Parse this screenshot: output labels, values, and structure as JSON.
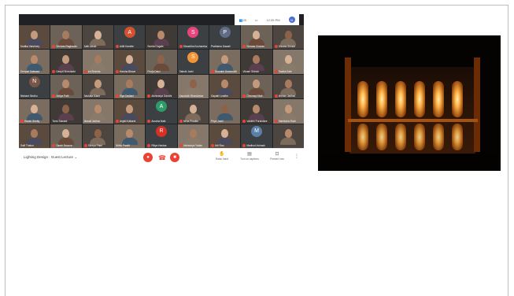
{
  "meeting": {
    "title": "Lighting Design : Guest Lecture",
    "time": "12:35 PM",
    "top_icons": {
      "people": "25",
      "chat_icon": "chat-icon"
    },
    "self_initial": "N",
    "controls": {
      "mic": "mic-off-icon",
      "hangup": "hangup-icon",
      "camera": "camera-off-icon"
    },
    "actions": [
      {
        "label": "Raise hand",
        "glyph": "✋"
      },
      {
        "label": "Turn on captions",
        "glyph": "▤"
      },
      {
        "label": "Present now",
        "glyph": "⊡"
      }
    ]
  },
  "participants": [
    {
      "name": "Kratika Varshney",
      "kind": "video",
      "muted": false
    },
    {
      "name": "Srinivas Raghavan",
      "kind": "video",
      "muted": true
    },
    {
      "name": "Aditi Lakde",
      "kind": "video",
      "muted": false
    },
    {
      "name": "Aditi Kamble",
      "kind": "initial",
      "initial": "A",
      "color": "#d35230",
      "muted": true
    },
    {
      "name": "Sneha Gugale",
      "kind": "video",
      "muted": false
    },
    {
      "name": "Shraddha Kocharekar",
      "kind": "initial",
      "initial": "S",
      "color": "#e8457c",
      "muted": true
    },
    {
      "name": "Prathama Gawali",
      "kind": "initial",
      "initial": "P",
      "color": "#5f6c84",
      "muted": false
    },
    {
      "name": "Suhaas Chavan",
      "kind": "video",
      "muted": true
    },
    {
      "name": "Shweta Shinde",
      "kind": "video",
      "muted": true
    },
    {
      "name": "Deepali Gaikwad",
      "kind": "video",
      "muted": false
    },
    {
      "name": "Deepti Sheshadri",
      "kind": "video",
      "muted": true
    },
    {
      "name": "Ira Sharma",
      "kind": "video",
      "muted": true
    },
    {
      "name": "Harsha Bhave",
      "kind": "video",
      "muted": true
    },
    {
      "name": "Pooja Dalvi",
      "kind": "video",
      "muted": false
    },
    {
      "name": "Sakshi Joshi",
      "kind": "initial",
      "initial": "S",
      "color": "#f29537",
      "muted": false
    },
    {
      "name": "Sourabh Deshmukh",
      "kind": "video",
      "muted": true
    },
    {
      "name": "Vikram Shinde",
      "kind": "video",
      "muted": false
    },
    {
      "name": "Rasika Kale",
      "kind": "video",
      "muted": true
    },
    {
      "name": "Nishant Sindhu",
      "kind": "initial",
      "initial": "N",
      "color": "#795548",
      "muted": false
    },
    {
      "name": "Aditya Patil",
      "kind": "video",
      "muted": true
    },
    {
      "name": "Akshata Mane",
      "kind": "video",
      "muted": false
    },
    {
      "name": "Siya Dadlani",
      "kind": "video",
      "muted": true
    },
    {
      "name": "Aishwarya Gandhi",
      "kind": "video",
      "muted": true
    },
    {
      "name": "Kaustubh Bhandarkar",
      "kind": "video",
      "muted": false
    },
    {
      "name": "Gayatri Londhe",
      "kind": "video",
      "muted": false
    },
    {
      "name": "Chinmayi Mali",
      "kind": "video",
      "muted": true
    },
    {
      "name": "Mohsin Jadhav",
      "kind": "video",
      "muted": true
    },
    {
      "name": "Harish Shetty",
      "kind": "video",
      "muted": true
    },
    {
      "name": "Tanvi Sawant",
      "kind": "video",
      "muted": false
    },
    {
      "name": "Manali Jadhav",
      "kind": "video",
      "muted": false
    },
    {
      "name": "Anjali Kulkarni",
      "kind": "video",
      "muted": true
    },
    {
      "name": "Anusha Naik",
      "kind": "initial",
      "initial": "A",
      "color": "#2e9c6a",
      "muted": true
    },
    {
      "name": "Neha Phadke",
      "kind": "video",
      "muted": true
    },
    {
      "name": "Priya Joshi",
      "kind": "video",
      "muted": false
    },
    {
      "name": "Vaidehi Purandare",
      "kind": "video",
      "muted": true
    },
    {
      "name": "Samiksha Shah",
      "kind": "video",
      "muted": true
    },
    {
      "name": "Salil Thakur",
      "kind": "video",
      "muted": false
    },
    {
      "name": "Sarah Dsouza",
      "kind": "video",
      "muted": true
    },
    {
      "name": "Shreya Patel",
      "kind": "video",
      "muted": true
    },
    {
      "name": "Nikita Pandit",
      "kind": "video",
      "muted": false
    },
    {
      "name": "Ritiya Hardas",
      "kind": "initial",
      "initial": "R",
      "color": "#d93025",
      "muted": true
    },
    {
      "name": "Aishwarya Yadav",
      "kind": "video",
      "muted": true
    },
    {
      "name": "Arti Rao",
      "kind": "video",
      "muted": true
    },
    {
      "name": "Madhuri Avinash",
      "kind": "initial",
      "initial": "M",
      "color": "#5b7fa6",
      "muted": true
    },
    {
      "name": "",
      "kind": "video",
      "muted": false
    }
  ],
  "photo": {
    "alt": "illuminated installation"
  }
}
